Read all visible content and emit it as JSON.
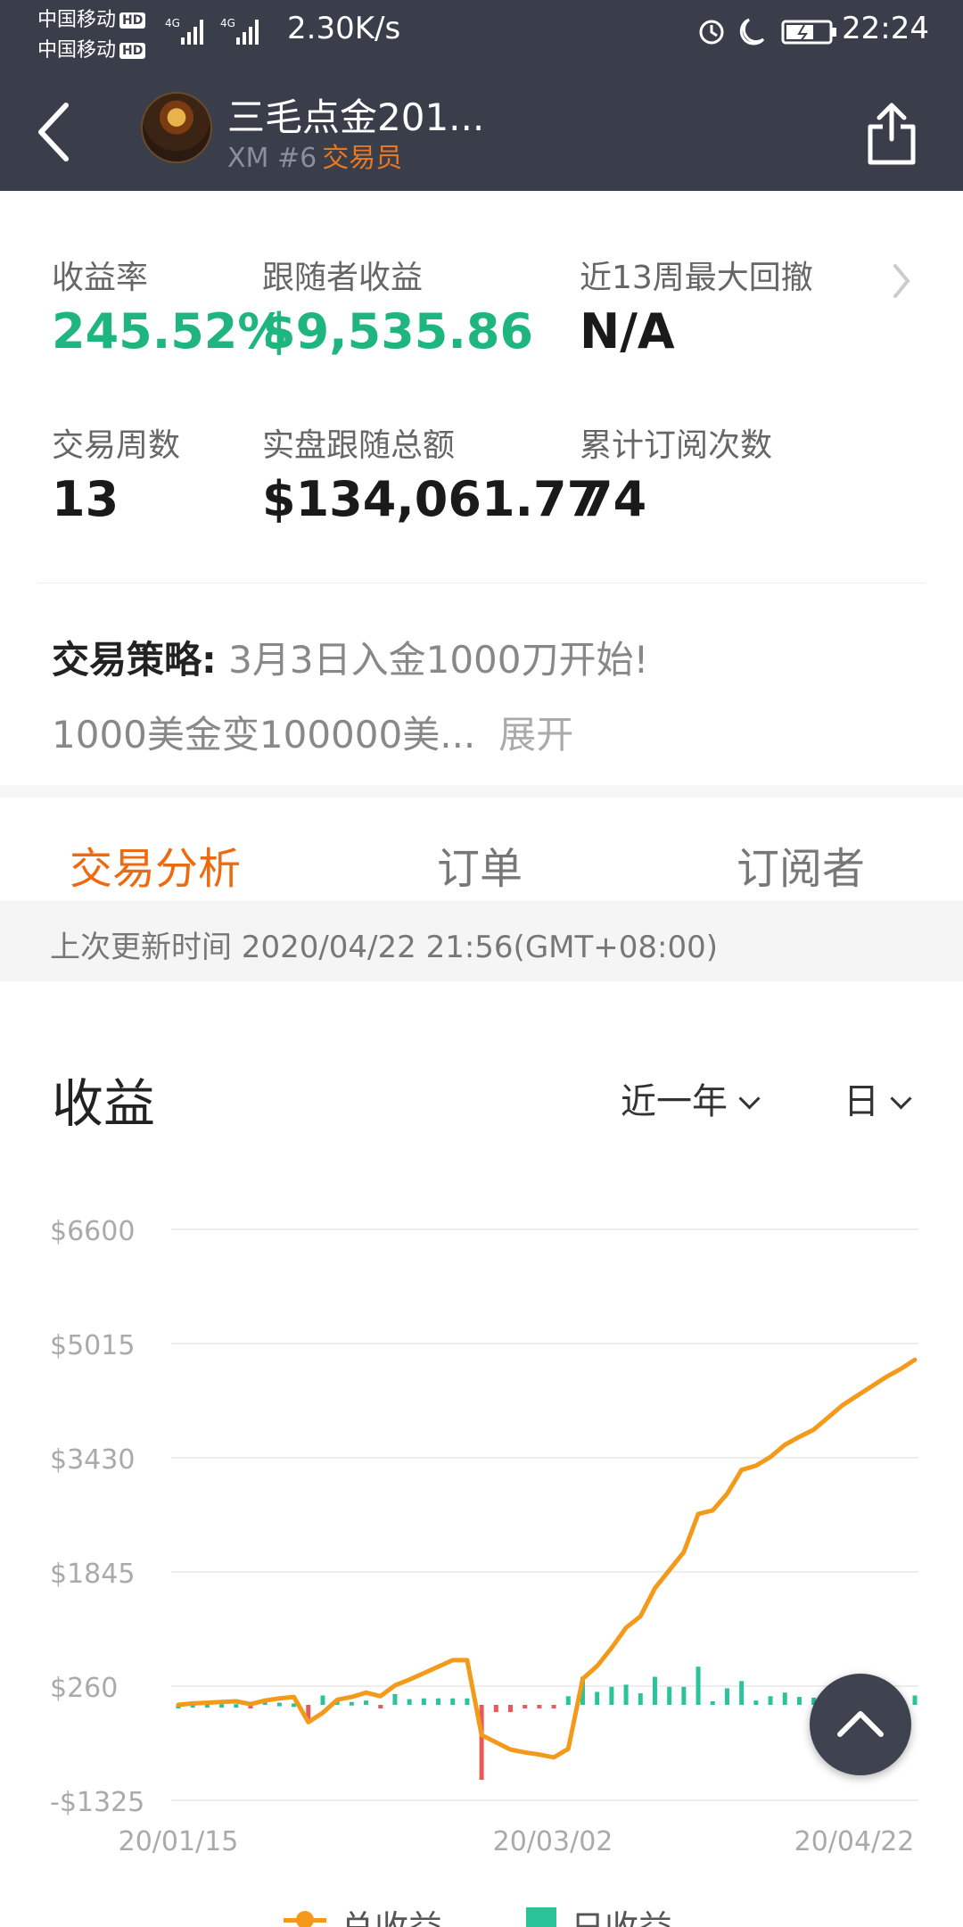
{
  "status_bar": {
    "carrier1": "中国移动",
    "carrier2": "中国移动",
    "hd": "HD",
    "net_speed": "2.30K/s",
    "time": "22:24"
  },
  "header": {
    "trader_name": "三毛点金201...",
    "trader_id": "XM #6",
    "trader_role": "交易员"
  },
  "stats": {
    "return_rate_label": "收益率",
    "return_rate_value": "245.52%",
    "follower_profit_label": "跟随者收益",
    "follower_profit_value": "$9,535.86",
    "max_drawdown_label": "近13周最大回撤",
    "max_drawdown_value": "N/A",
    "trade_weeks_label": "交易周数",
    "trade_weeks_value": "13",
    "live_follow_total_label": "实盘跟随总额",
    "live_follow_total_value": "$134,061.77",
    "subscriptions_label": "累计订阅次数",
    "subscriptions_value": "74"
  },
  "strategy": {
    "label": "交易策略:",
    "text_line1": "3月3日入金1000刀开始!",
    "text_line2": "1000美金变100000美...",
    "expand": "展开"
  },
  "tabs": [
    {
      "label": "交易分析",
      "active": true
    },
    {
      "label": "订单",
      "active": false
    },
    {
      "label": "订阅者",
      "active": false
    }
  ],
  "update": {
    "text": "上次更新时间 2020/04/22 21:56(GMT+08:00)"
  },
  "profit_section": {
    "title": "收益",
    "range_dropdown": "近一年",
    "period_dropdown": "日"
  },
  "colors": {
    "accent_orange": "#ee6a10",
    "profit_green": "#1eb57e",
    "bar_green": "#2bc49a",
    "bar_red": "#e85a5a",
    "line_orange": "#f39a1a",
    "header_bg": "#3a3e4a"
  },
  "chart_data": {
    "type": "line",
    "title": "收益",
    "ylim": [
      -1325,
      6600
    ],
    "y_ticks": [
      "$6600",
      "$5015",
      "$3430",
      "$1845",
      "$260",
      "-$1325"
    ],
    "y_tick_values": [
      6600,
      5015,
      3430,
      1845,
      260,
      -1325
    ],
    "x_ticks": [
      "20/01/15",
      "20/03/02",
      "20/04/22"
    ],
    "legend": [
      "总收益",
      "日收益"
    ],
    "series": [
      {
        "name": "总收益",
        "type": "line",
        "values": [
          0,
          20,
          30,
          40,
          50,
          10,
          60,
          90,
          110,
          -240,
          -110,
          70,
          110,
          170,
          120,
          270,
          350,
          440,
          530,
          620,
          620,
          -420,
          -520,
          -620,
          -660,
          -690,
          -730,
          -610,
          360,
          540,
          790,
          1070,
          1230,
          1620,
          1870,
          2120,
          2650,
          2700,
          2930,
          3260,
          3320,
          3440,
          3610,
          3720,
          3820,
          3990,
          4160,
          4290,
          4420,
          4550,
          4660,
          4790
        ]
      },
      {
        "name": "日收益",
        "type": "bar",
        "values": [
          0,
          10,
          10,
          10,
          10,
          -40,
          50,
          30,
          20,
          -230,
          130,
          80,
          40,
          60,
          -50,
          150,
          80,
          90,
          90,
          90,
          90,
          -1040,
          -100,
          -100,
          -40,
          -30,
          -40,
          120,
          390,
          180,
          250,
          280,
          160,
          390,
          250,
          250,
          530,
          50,
          230,
          330,
          60,
          120,
          170,
          110,
          100,
          170,
          170,
          130,
          130,
          130,
          110,
          130
        ]
      }
    ]
  }
}
